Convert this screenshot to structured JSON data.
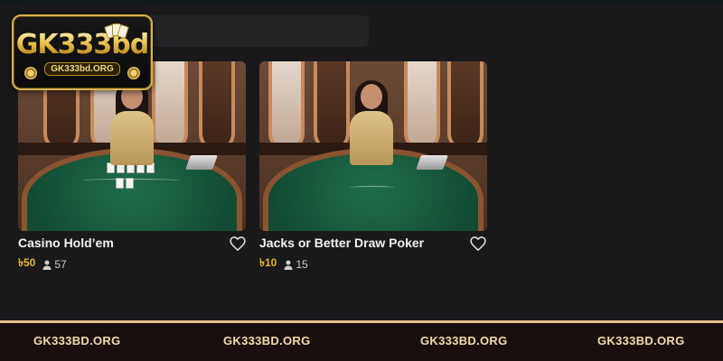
{
  "logo": {
    "main_text": "GK333bd",
    "sub_text": "GK333bd.ORG"
  },
  "games": [
    {
      "title": "Casino Hold’em",
      "bet": "৳50",
      "players": "57",
      "favorite_icon": "heart-outline-icon"
    },
    {
      "title": "Jacks or Better Draw Poker",
      "bet": "৳10",
      "players": "15",
      "favorite_icon": "heart-outline-icon"
    }
  ],
  "footer": {
    "items": [
      "GK333BD.ORG",
      "GK333BD.ORG",
      "GK333BD.ORG",
      "GK333BD.ORG"
    ]
  },
  "colors": {
    "background": "#19191b",
    "bet_accent": "#e5b42f",
    "footer_border": "#e6c38a",
    "footer_text": "#f1dcaa",
    "logo_gold": "#d8b24a"
  }
}
